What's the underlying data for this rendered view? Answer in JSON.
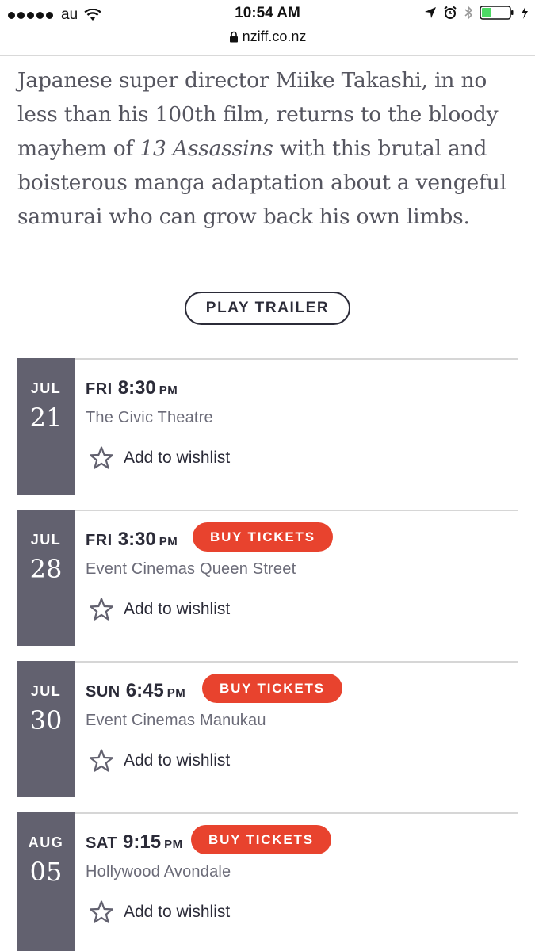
{
  "status_bar": {
    "carrier": "au",
    "time": "10:54 AM",
    "url": "nziff.co.nz"
  },
  "description": {
    "before_title": "Japanese super director Miike Takashi, in no less than his 100th film, returns to the bloody mayhem of ",
    "film_title": "13 Assassins",
    "after_title": " with this brutal and boisterous manga adaptation about a vengeful samurai who can grow back his own limbs."
  },
  "trailer_button": "PLAY TRAILER",
  "screenings": [
    {
      "month": "JUL",
      "day": "21",
      "weekday": "FRI",
      "time": "8:30",
      "ampm": "PM",
      "venue": "The Civic Theatre",
      "buy_label": "",
      "wishlist": "Add to wishlist"
    },
    {
      "month": "JUL",
      "day": "28",
      "weekday": "FRI",
      "time": "3:30",
      "ampm": "PM",
      "venue": "Event Cinemas Queen Street",
      "buy_label": "BUY TICKETS",
      "wishlist": "Add to wishlist"
    },
    {
      "month": "JUL",
      "day": "30",
      "weekday": "SUN",
      "time": "6:45",
      "ampm": "PM",
      "venue": "Event Cinemas Manukau",
      "buy_label": "BUY TICKETS",
      "wishlist": "Add to wishlist"
    },
    {
      "month": "AUG",
      "day": "05",
      "weekday": "SAT",
      "time": "9:15",
      "ampm": "PM",
      "venue": "Hollywood Avondale",
      "buy_label": "BUY TICKETS",
      "wishlist": "Add to wishlist"
    }
  ],
  "colors": {
    "accent": "#e8432e",
    "date_box": "#62616f",
    "text_dark": "#2b2b38",
    "text_muted": "#6b6b78"
  }
}
